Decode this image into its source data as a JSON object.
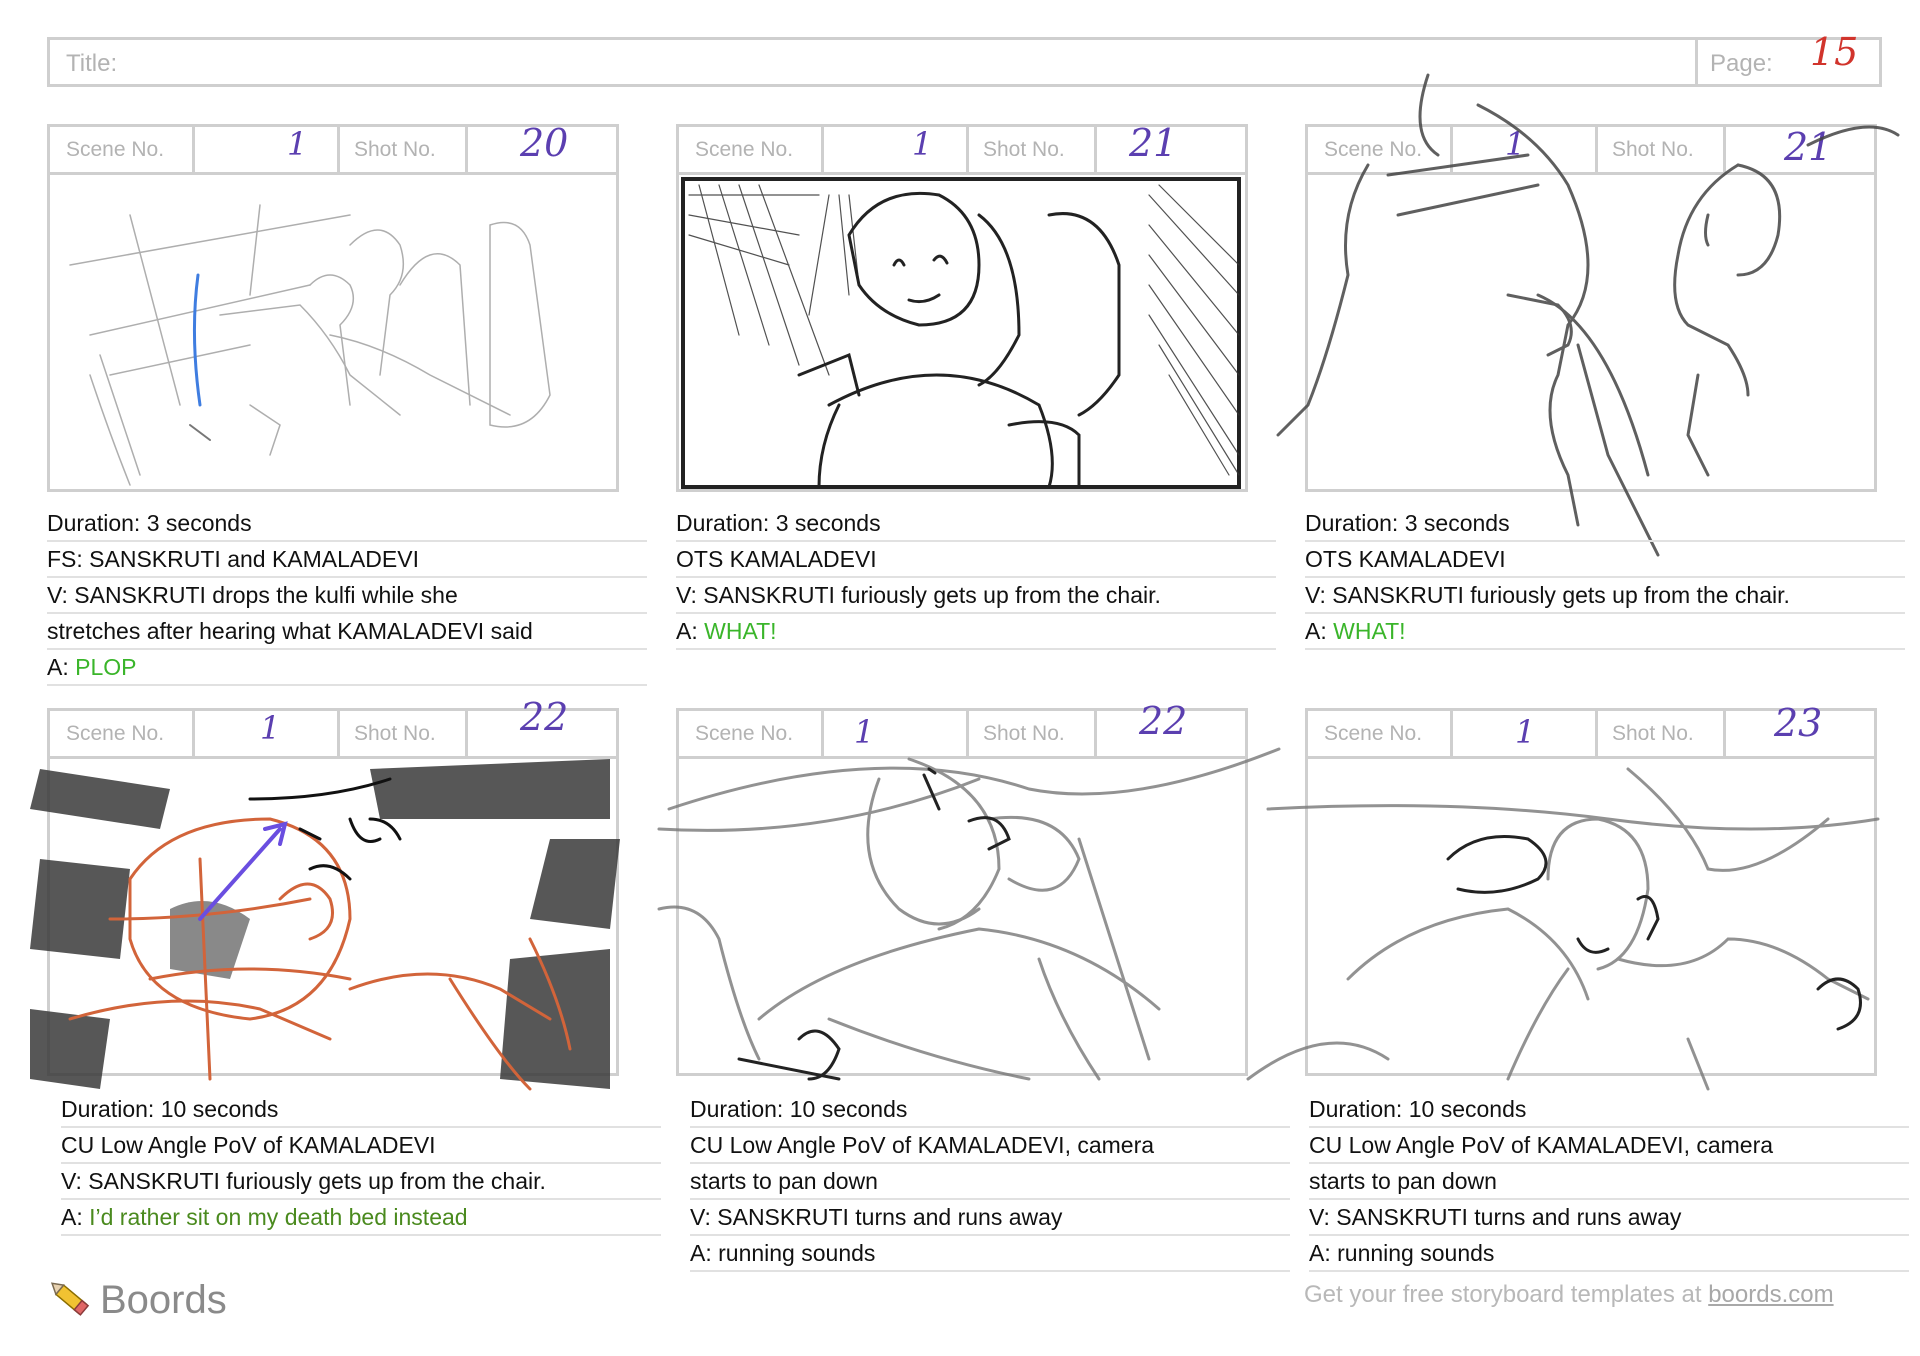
{
  "header": {
    "title_label": "Title:",
    "page_label": "Page:",
    "page_number": "15"
  },
  "panels": [
    {
      "scene_label": "Scene No.",
      "shot_label": "Shot No.",
      "scene": "1",
      "shot": "20",
      "lines": [
        "Duration: 3 seconds",
        "FS: SANSKRUTI and KAMALADEVI",
        "V: SANSKRUTI drops the kulfi while she",
        "stretches after hearing what KAMALADEVI said"
      ],
      "audio_prefix": " A: ",
      "audio": "PLOP"
    },
    {
      "scene_label": "Scene No.",
      "shot_label": "Shot No.",
      "scene": "1",
      "shot": "21",
      "lines": [
        "Duration: 3 seconds",
        "OTS KAMALADEVI",
        "V: SANSKRUTI furiously gets up from the chair."
      ],
      "audio_prefix": "A: ",
      "audio": "WHAT!"
    },
    {
      "scene_label": "Scene No.",
      "shot_label": "Shot No.",
      "scene": "1",
      "shot": "21",
      "lines": [
        "Duration: 3 seconds",
        "OTS KAMALADEVI",
        "V: SANSKRUTI furiously gets up from the chair."
      ],
      "audio_prefix": "A: ",
      "audio": "WHAT!"
    },
    {
      "scene_label": "Scene No.",
      "shot_label": "Shot No.",
      "scene": "1",
      "shot": "22",
      "lines": [
        "Duration: 10 seconds",
        "CU Low Angle PoV of  KAMALADEVI",
        "V: SANSKRUTI furiously gets up from the chair."
      ],
      "audio_prefix": "A: ",
      "audio": "I’d rather sit on my death bed instead"
    },
    {
      "scene_label": "Scene No.",
      "shot_label": "Shot No.",
      "scene": "1",
      "shot": "22",
      "lines": [
        "Duration: 10 seconds",
        "CU Low Angle PoV of  KAMALADEVI, camera",
        "starts to pan down",
        "V: SANSKRUTI turns and runs away",
        "A: running sounds"
      ]
    },
    {
      "scene_label": "Scene No.",
      "shot_label": "Shot No.",
      "scene": "1",
      "shot": "23",
      "lines": [
        "Duration: 10 seconds",
        "CU Low Angle PoV of  KAMALADEVI, camera",
        "starts to pan down",
        "V: SANSKRUTI turns and runs away",
        "A: running sounds"
      ]
    }
  ],
  "footer": {
    "brand": "Boords",
    "promo": "Get your free storyboard templates at ",
    "link": "boords.com"
  }
}
